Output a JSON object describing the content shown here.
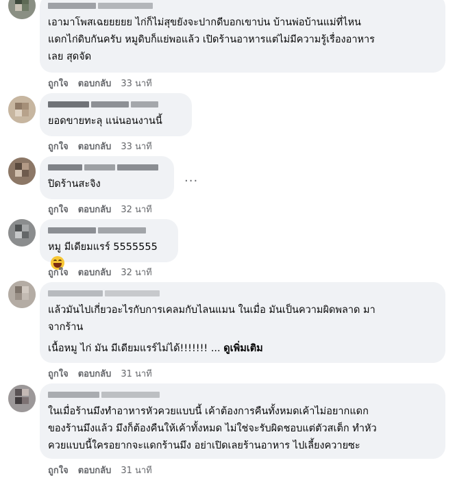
{
  "labels": {
    "like": "ถูกใจ",
    "reply": "ตอบกลับ",
    "see_more": "ดูเพิ่มเติม",
    "more_options": "..."
  },
  "comments": [
    {
      "text": "เอามาโพสเฉยยยยย ไก่ก็ไม่สุขยังจะปากดีบอกเขาบ่น บ้านพ่อบ้านแม่ที่ไหน\nแดกไก่ดิบกันครับ หมูดิบก็แย่พอแล้ว เปิดร้านอาหารแต่ไม่มีความรู้เรื่องอาหาร\nเลย สุดจัด",
      "time": "33 นาที"
    },
    {
      "text": "ยอดขายทะลุ แน่นอนงานนี้",
      "time": "33 นาที"
    },
    {
      "text": "ปิดร้านสะจิง",
      "time": "32 นาที"
    },
    {
      "text": "หมู มีเดียมแรร์ 5555555",
      "time": "32 นาที",
      "emoji": "laughing-emoji"
    },
    {
      "text": "แล้วมันไปเกี่ยวอะไรกับการเคลมกับไลนแมน ในเมื่อ มันเป็นความผิดพลาด มา\nจากร้าน",
      "text2": "เนื้อหมู ไก่ มัน มีเดียมแรร์ไม่ได้!!!!!!! ...",
      "time": "31 นาที"
    },
    {
      "text": "ในเมื่อร้านมึงทำอาหารหัวควยแบบนี้ เค้าต้องการคืนทั้งหมดเค้าไม่อยากแดก\nของร้านมึงแล้ว มึงก็ต้องคืนให้เค้าทั้งหมด ไม่ใช่จะรับผิดชอบแต่ตัวสเต็ก ทำหัว\nควยแบบนี้ใครอยากจะแดกร้านมึง อย่าเปิดเลยร้านอาหาร ไปเลี้ยงควายซะ",
      "time": "31 นาที"
    }
  ]
}
